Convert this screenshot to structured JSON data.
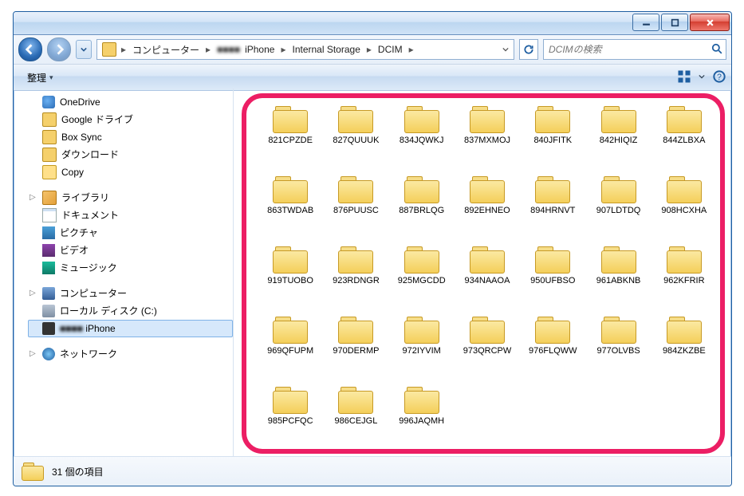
{
  "titlebar": {
    "min": "–",
    "max": "▢",
    "close": "×"
  },
  "nav": {
    "crumbs": [
      "コンピューター",
      "'s iPhone",
      "Internal Storage",
      "DCIM"
    ],
    "crumb_hidden": "■■■■",
    "search_placeholder": "DCIMの検索"
  },
  "toolbar": {
    "organize": "整理",
    "organize_arrow": "▾"
  },
  "sidebar": {
    "fav": [
      {
        "label": "OneDrive",
        "ic": "ic-cloud"
      },
      {
        "label": "Google ドライブ",
        "ic": "ic-fold"
      },
      {
        "label": "Box Sync",
        "ic": "ic-fold"
      },
      {
        "label": "ダウンロード",
        "ic": "ic-fold"
      },
      {
        "label": "Copy",
        "ic": "ic-copy"
      }
    ],
    "lib_title": "ライブラリ",
    "lib": [
      {
        "label": "ドキュメント",
        "ic": "ic-doc"
      },
      {
        "label": "ピクチャ",
        "ic": "ic-pic"
      },
      {
        "label": "ビデオ",
        "ic": "ic-vid"
      },
      {
        "label": "ミュージック",
        "ic": "ic-mus"
      }
    ],
    "comp_title": "コンピューター",
    "comp": [
      {
        "label": "ローカル ディスク (C:)",
        "ic": "ic-hdd"
      },
      {
        "label": "iPhone",
        "ic": "ic-phone",
        "blur_prefix": "■■■■ "
      }
    ],
    "net_title": "ネットワーク"
  },
  "folders": [
    "821CPZDE",
    "827QUUUK",
    "834JQWKJ",
    "837MXMOJ",
    "840JFITK",
    "842HIQIZ",
    "844ZLBXA",
    "863TWDAB",
    "876PUUSC",
    "887BRLQG",
    "892EHNEO",
    "894HRNVT",
    "907LDTDQ",
    "908HCXHA",
    "919TUOBO",
    "923RDNGR",
    "925MGCDD",
    "934NAAOA",
    "950UFBSO",
    "961ABKNB",
    "962KFRIR",
    "969QFUPM",
    "970DERMP",
    "972IYVIM",
    "973QRCPW",
    "976FLQWW",
    "977OLVBS",
    "984ZKZBE",
    "985PCFQC",
    "986CEJGL",
    "996JAQMH"
  ],
  "status": {
    "count": "31 個の項目"
  }
}
